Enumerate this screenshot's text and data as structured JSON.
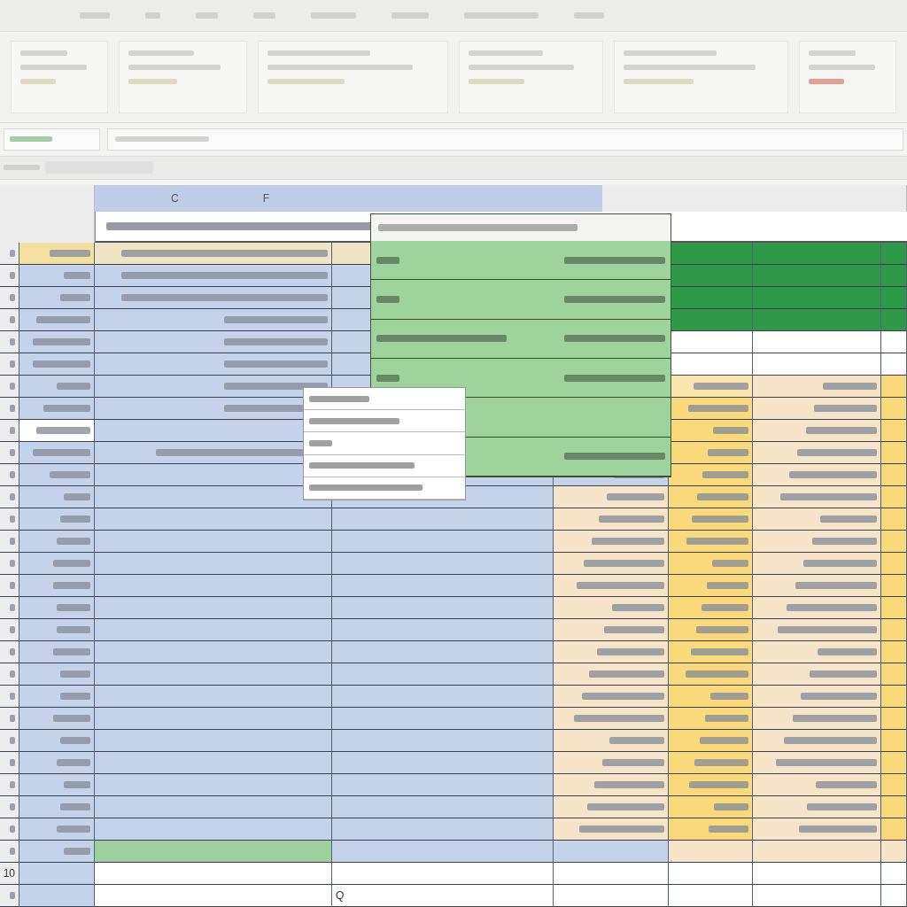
{
  "column_headers": [
    {
      "label": "C"
    },
    {
      "label": "F"
    }
  ],
  "row_label": "10",
  "cell_value": "Q"
}
